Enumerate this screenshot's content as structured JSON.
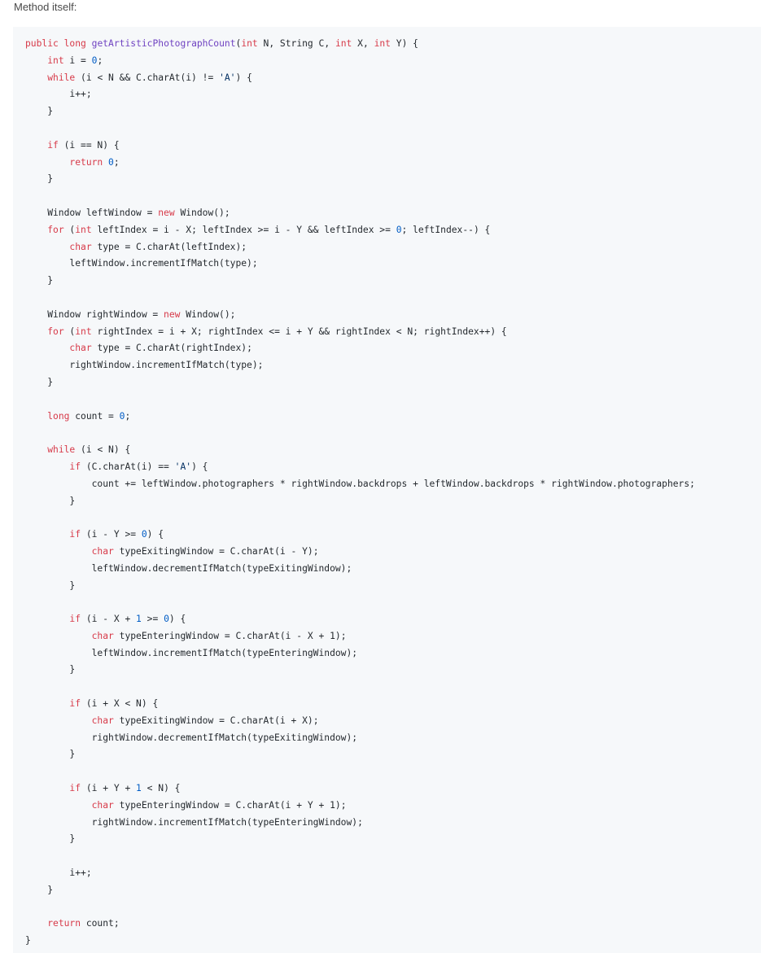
{
  "intro_text": "Method itself:",
  "code_lines": [
    [
      [
        "kw",
        "public"
      ],
      [
        "plain",
        " "
      ],
      [
        "kw",
        "long"
      ],
      [
        "plain",
        " "
      ],
      [
        "fn",
        "getArtisticPhotographCount"
      ],
      [
        "plain",
        "("
      ],
      [
        "kw",
        "int"
      ],
      [
        "plain",
        " N, String C, "
      ],
      [
        "kw",
        "int"
      ],
      [
        "plain",
        " X, "
      ],
      [
        "kw",
        "int"
      ],
      [
        "plain",
        " Y) {"
      ]
    ],
    [
      [
        "plain",
        "    "
      ],
      [
        "kw",
        "int"
      ],
      [
        "plain",
        " i = "
      ],
      [
        "num",
        "0"
      ],
      [
        "plain",
        ";"
      ]
    ],
    [
      [
        "plain",
        "    "
      ],
      [
        "kw",
        "while"
      ],
      [
        "plain",
        " (i < N && C.charAt(i) != "
      ],
      [
        "str",
        "'A'"
      ],
      [
        "plain",
        ") {"
      ]
    ],
    [
      [
        "plain",
        "        i++;"
      ]
    ],
    [
      [
        "plain",
        "    }"
      ]
    ],
    [
      [
        "plain",
        ""
      ]
    ],
    [
      [
        "plain",
        "    "
      ],
      [
        "kw",
        "if"
      ],
      [
        "plain",
        " (i == N) {"
      ]
    ],
    [
      [
        "plain",
        "        "
      ],
      [
        "kw",
        "return"
      ],
      [
        "plain",
        " "
      ],
      [
        "num",
        "0"
      ],
      [
        "plain",
        ";"
      ]
    ],
    [
      [
        "plain",
        "    }"
      ]
    ],
    [
      [
        "plain",
        ""
      ]
    ],
    [
      [
        "plain",
        "    Window leftWindow = "
      ],
      [
        "kw",
        "new"
      ],
      [
        "plain",
        " Window();"
      ]
    ],
    [
      [
        "plain",
        "    "
      ],
      [
        "kw",
        "for"
      ],
      [
        "plain",
        " ("
      ],
      [
        "kw",
        "int"
      ],
      [
        "plain",
        " leftIndex = i - X; leftIndex >= i - Y && leftIndex >= "
      ],
      [
        "num",
        "0"
      ],
      [
        "plain",
        "; leftIndex--) {"
      ]
    ],
    [
      [
        "plain",
        "        "
      ],
      [
        "kw",
        "char"
      ],
      [
        "plain",
        " type = C.charAt(leftIndex);"
      ]
    ],
    [
      [
        "plain",
        "        leftWindow.incrementIfMatch(type);"
      ]
    ],
    [
      [
        "plain",
        "    }"
      ]
    ],
    [
      [
        "plain",
        ""
      ]
    ],
    [
      [
        "plain",
        "    Window rightWindow = "
      ],
      [
        "kw",
        "new"
      ],
      [
        "plain",
        " Window();"
      ]
    ],
    [
      [
        "plain",
        "    "
      ],
      [
        "kw",
        "for"
      ],
      [
        "plain",
        " ("
      ],
      [
        "kw",
        "int"
      ],
      [
        "plain",
        " rightIndex = i + X; rightIndex <= i + Y && rightIndex < N; rightIndex++) {"
      ]
    ],
    [
      [
        "plain",
        "        "
      ],
      [
        "kw",
        "char"
      ],
      [
        "plain",
        " type = C.charAt(rightIndex);"
      ]
    ],
    [
      [
        "plain",
        "        rightWindow.incrementIfMatch(type);"
      ]
    ],
    [
      [
        "plain",
        "    }"
      ]
    ],
    [
      [
        "plain",
        ""
      ]
    ],
    [
      [
        "plain",
        "    "
      ],
      [
        "kw",
        "long"
      ],
      [
        "plain",
        " count = "
      ],
      [
        "num",
        "0"
      ],
      [
        "plain",
        ";"
      ]
    ],
    [
      [
        "plain",
        ""
      ]
    ],
    [
      [
        "plain",
        "    "
      ],
      [
        "kw",
        "while"
      ],
      [
        "plain",
        " (i < N) {"
      ]
    ],
    [
      [
        "plain",
        "        "
      ],
      [
        "kw",
        "if"
      ],
      [
        "plain",
        " (C.charAt(i) == "
      ],
      [
        "str",
        "'A'"
      ],
      [
        "plain",
        ") {"
      ]
    ],
    [
      [
        "plain",
        "            count += leftWindow.photographers * rightWindow.backdrops + leftWindow.backdrops * rightWindow.photographers;"
      ]
    ],
    [
      [
        "plain",
        "        }"
      ]
    ],
    [
      [
        "plain",
        ""
      ]
    ],
    [
      [
        "plain",
        "        "
      ],
      [
        "kw",
        "if"
      ],
      [
        "plain",
        " (i - Y >= "
      ],
      [
        "num",
        "0"
      ],
      [
        "plain",
        ") {"
      ]
    ],
    [
      [
        "plain",
        "            "
      ],
      [
        "kw",
        "char"
      ],
      [
        "plain",
        " typeExitingWindow = C.charAt(i - Y);"
      ]
    ],
    [
      [
        "plain",
        "            leftWindow.decrementIfMatch(typeExitingWindow);"
      ]
    ],
    [
      [
        "plain",
        "        }"
      ]
    ],
    [
      [
        "plain",
        ""
      ]
    ],
    [
      [
        "plain",
        "        "
      ],
      [
        "kw",
        "if"
      ],
      [
        "plain",
        " (i - X + "
      ],
      [
        "num",
        "1"
      ],
      [
        "plain",
        " >= "
      ],
      [
        "num",
        "0"
      ],
      [
        "plain",
        ") {"
      ]
    ],
    [
      [
        "plain",
        "            "
      ],
      [
        "kw",
        "char"
      ],
      [
        "plain",
        " typeEnteringWindow = C.charAt(i - X + 1);"
      ]
    ],
    [
      [
        "plain",
        "            leftWindow.incrementIfMatch(typeEnteringWindow);"
      ]
    ],
    [
      [
        "plain",
        "        }"
      ]
    ],
    [
      [
        "plain",
        ""
      ]
    ],
    [
      [
        "plain",
        "        "
      ],
      [
        "kw",
        "if"
      ],
      [
        "plain",
        " (i + X < N) {"
      ]
    ],
    [
      [
        "plain",
        "            "
      ],
      [
        "kw",
        "char"
      ],
      [
        "plain",
        " typeExitingWindow = C.charAt(i + X);"
      ]
    ],
    [
      [
        "plain",
        "            rightWindow.decrementIfMatch(typeExitingWindow);"
      ]
    ],
    [
      [
        "plain",
        "        }"
      ]
    ],
    [
      [
        "plain",
        ""
      ]
    ],
    [
      [
        "plain",
        "        "
      ],
      [
        "kw",
        "if"
      ],
      [
        "plain",
        " (i + Y + "
      ],
      [
        "num",
        "1"
      ],
      [
        "plain",
        " < N) {"
      ]
    ],
    [
      [
        "plain",
        "            "
      ],
      [
        "kw",
        "char"
      ],
      [
        "plain",
        " typeEnteringWindow = C.charAt(i + Y + 1);"
      ]
    ],
    [
      [
        "plain",
        "            rightWindow.incrementIfMatch(typeEnteringWindow);"
      ]
    ],
    [
      [
        "plain",
        "        }"
      ]
    ],
    [
      [
        "plain",
        ""
      ]
    ],
    [
      [
        "plain",
        "        i++;"
      ]
    ],
    [
      [
        "plain",
        "    }"
      ]
    ],
    [
      [
        "plain",
        ""
      ]
    ],
    [
      [
        "plain",
        "    "
      ],
      [
        "kw",
        "return"
      ],
      [
        "plain",
        " count;"
      ]
    ],
    [
      [
        "plain",
        "}"
      ]
    ]
  ]
}
